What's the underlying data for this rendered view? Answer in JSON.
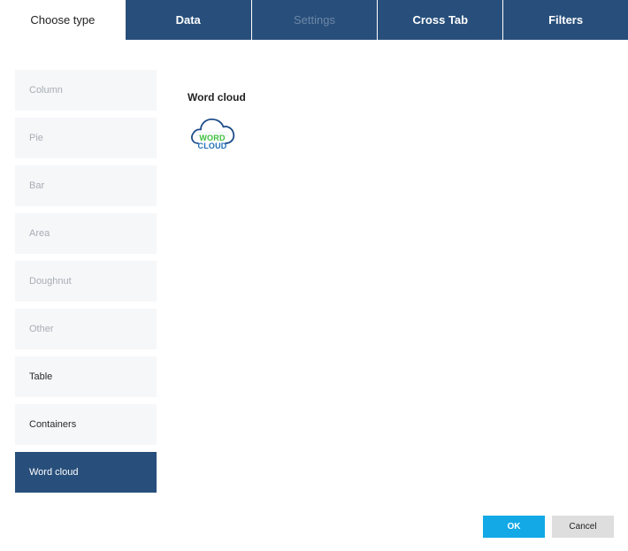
{
  "tabs": [
    {
      "label": "Choose type"
    },
    {
      "label": "Data"
    },
    {
      "label": "Settings"
    },
    {
      "label": "Cross Tab"
    },
    {
      "label": "Filters"
    }
  ],
  "chart_types": [
    {
      "label": "Column"
    },
    {
      "label": "Pie"
    },
    {
      "label": "Bar"
    },
    {
      "label": "Area"
    },
    {
      "label": "Doughnut"
    },
    {
      "label": "Other"
    },
    {
      "label": "Table"
    },
    {
      "label": "Containers"
    },
    {
      "label": "Word cloud"
    }
  ],
  "panel": {
    "title": "Word cloud",
    "icon": {
      "name": "word-cloud-icon",
      "word": "WORD",
      "cloud": "CLOUD"
    }
  },
  "buttons": {
    "ok": "OK",
    "cancel": "Cancel"
  },
  "colors": {
    "navy": "#284f7b",
    "ok_blue": "#12a9e6",
    "disabled_tab_text": "#6d86a6"
  }
}
